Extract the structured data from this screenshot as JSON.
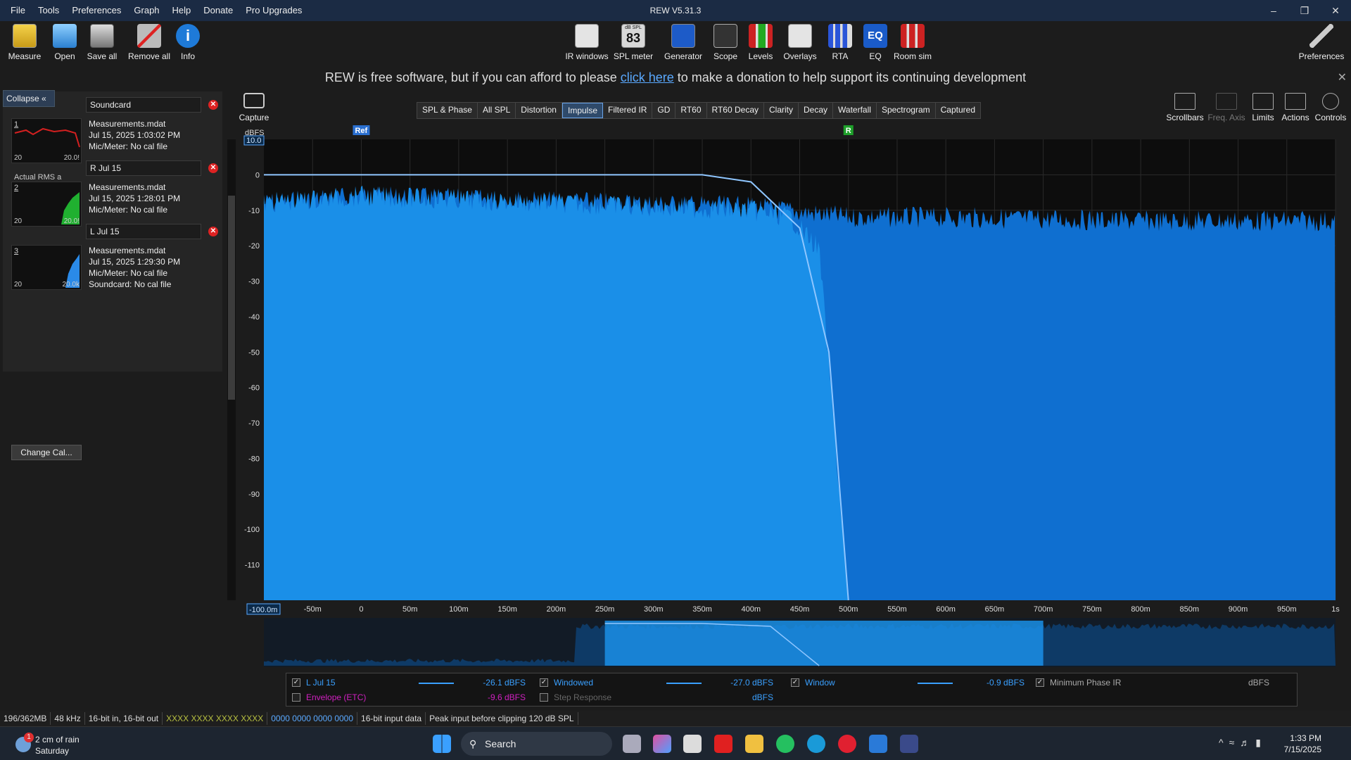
{
  "window": {
    "title": "REW V5.31.3",
    "menu": [
      "File",
      "Tools",
      "Preferences",
      "Graph",
      "Help",
      "Donate",
      "Pro Upgrades"
    ]
  },
  "toolbar": {
    "left": [
      {
        "label": "Measure",
        "icon": "measure-icon"
      },
      {
        "label": "Open",
        "icon": "folder-icon"
      },
      {
        "label": "Save all",
        "icon": "save-icon"
      },
      {
        "label": "Remove all",
        "icon": "remove-icon"
      },
      {
        "label": "Info",
        "icon": "info-icon"
      }
    ],
    "center": [
      {
        "label": "IR windows",
        "icon": "ir-windows-icon"
      },
      {
        "label": "SPL meter",
        "icon": "spl-meter-icon",
        "readout": "83",
        "unit": "dB SPL"
      },
      {
        "label": "Generator",
        "icon": "generator-icon"
      },
      {
        "label": "Scope",
        "icon": "scope-icon"
      },
      {
        "label": "Levels",
        "icon": "levels-icon"
      },
      {
        "label": "Overlays",
        "icon": "overlays-icon"
      },
      {
        "label": "RTA",
        "icon": "rta-icon"
      },
      {
        "label": "EQ",
        "icon": "eq-icon"
      },
      {
        "label": "Room sim",
        "icon": "room-sim-icon"
      }
    ],
    "preferences": "Preferences"
  },
  "donate": {
    "before": "REW is free software, but if you can afford to please ",
    "link": "click here",
    "after": " to make a donation to help support its continuing development"
  },
  "panel": {
    "collapse": "Collapse",
    "change_cal": "Change Cal...",
    "measurements": [
      {
        "num": "1",
        "name": "Soundcard",
        "file": "Measurements.mdat",
        "date": "Jul 15, 2025 1:03:02 PM",
        "mic": "Mic/Meter: No cal file",
        "extra": "Actual RMS a",
        "lo": "20",
        "hi": "20.0!",
        "color": "#d42020"
      },
      {
        "num": "2",
        "name": "R Jul 15",
        "file": "Measurements.mdat",
        "date": "Jul 15, 2025 1:28:01 PM",
        "mic": "Mic/Meter: No cal file",
        "lo": "20",
        "hi": "20.0!",
        "color": "#20b030"
      },
      {
        "num": "3",
        "name": "L Jul 15",
        "file": "Measurements.mdat",
        "date": "Jul 15, 2025 1:29:30 PM",
        "mic": "Mic/Meter: No cal file",
        "soundcard": "Soundcard: No cal file",
        "lo": "20",
        "hi": "20.0k",
        "color": "#2a8ae8"
      }
    ]
  },
  "graph": {
    "capture": "Capture",
    "tabs": [
      "SPL & Phase",
      "All SPL",
      "Distortion",
      "Impulse",
      "Filtered IR",
      "GD",
      "RT60",
      "RT60 Decay",
      "Clarity",
      "Decay",
      "Waterfall",
      "Spectrogram",
      "Captured"
    ],
    "active_tab": "Impulse",
    "right_tools": [
      "Scrollbars",
      "Freq. Axis",
      "Limits",
      "Actions",
      "Controls"
    ],
    "unit": "dBFS",
    "ymax_box": "10.0",
    "xmin_box": "-100.0m",
    "ref_marker": "Ref",
    "r_marker": "R"
  },
  "chart_data": {
    "type": "area",
    "title": "",
    "ylabel": "dBFS",
    "xlabel": "",
    "ylim": [
      -120,
      10
    ],
    "xlim": [
      -0.1,
      1.0
    ],
    "y_ticks": [
      "0",
      "-10",
      "-20",
      "-30",
      "-40",
      "-50",
      "-60",
      "-70",
      "-80",
      "-90",
      "-100",
      "-110"
    ],
    "y_tick_values": [
      0,
      -10,
      -20,
      -30,
      -40,
      -50,
      -60,
      -70,
      -80,
      -90,
      -100,
      -110
    ],
    "x_ticks": [
      "-50m",
      "0",
      "50m",
      "100m",
      "150m",
      "200m",
      "250m",
      "300m",
      "350m",
      "400m",
      "450m",
      "500m",
      "550m",
      "600m",
      "650m",
      "700m",
      "750m",
      "800m",
      "850m",
      "900m",
      "950m",
      "1s"
    ],
    "x_tick_values": [
      -0.05,
      0,
      0.05,
      0.1,
      0.15,
      0.2,
      0.25,
      0.3,
      0.35,
      0.4,
      0.45,
      0.5,
      0.55,
      0.6,
      0.65,
      0.7,
      0.75,
      0.8,
      0.85,
      0.9,
      0.95,
      1.0
    ],
    "series": [
      {
        "name": "L Jul 15",
        "color": "#1a8fe8",
        "x": [
          -0.1,
          0.0,
          0.2,
          0.4,
          0.44,
          0.47,
          0.5,
          1.0
        ],
        "y": [
          -7,
          -5,
          -7,
          -9,
          -11,
          -20,
          -120,
          -120
        ]
      },
      {
        "name": "Windowed",
        "color": "#0f6fd0",
        "x": [
          -0.1,
          0.0,
          0.4,
          0.5,
          0.6,
          0.8,
          1.0
        ],
        "y": [
          -7,
          -5,
          -8,
          -11,
          -11,
          -12,
          -12
        ]
      },
      {
        "name": "Window",
        "color": "#8fc6ff",
        "x": [
          -0.1,
          0.0,
          0.3,
          0.35,
          0.4,
          0.45,
          0.48,
          0.5
        ],
        "y": [
          0,
          0,
          0,
          0,
          -2,
          -15,
          -50,
          -120
        ]
      }
    ],
    "overview_window": [
      0.25,
      0.7
    ]
  },
  "legend": {
    "rows": [
      {
        "label": "L Jul 15",
        "value": "-26.1 dBFS",
        "checked": true,
        "color": "#3aa0ff",
        "vcolor": "#3aa0ff"
      },
      {
        "label": "Windowed",
        "value": "-27.0 dBFS",
        "checked": true,
        "color": "#3aa0ff",
        "vcolor": "#3aa0ff"
      },
      {
        "label": "Window",
        "value": "-0.9 dBFS",
        "checked": true,
        "color": "#3aa0ff",
        "vcolor": "#3aa0ff"
      },
      {
        "label": "Minimum Phase IR",
        "value": "dBFS",
        "checked": true,
        "color": "#aaaaaa",
        "vcolor": "#aaaaaa"
      },
      {
        "label": "Envelope (ETC)",
        "value": "-9.6 dBFS",
        "checked": false,
        "color": "#d020c0",
        "vcolor": "#d020c0"
      },
      {
        "label": "Step Response",
        "value": "dBFS",
        "checked": false,
        "color": "#666666",
        "vcolor": "#3aa0ff"
      }
    ]
  },
  "status": {
    "items": [
      "196/362MB",
      "48 kHz",
      "16-bit in, 16-bit out",
      "XXXX XXXX  XXXX XXXX",
      "0000 0000  0000 0000",
      "16-bit input data",
      "Peak input before clipping 120 dB SPL"
    ]
  },
  "taskbar": {
    "weather": "2 cm of rain",
    "weather_day": "Saturday",
    "weather_badge": "1",
    "search": "Search",
    "time": "1:33 PM",
    "date": "7/15/2025"
  }
}
